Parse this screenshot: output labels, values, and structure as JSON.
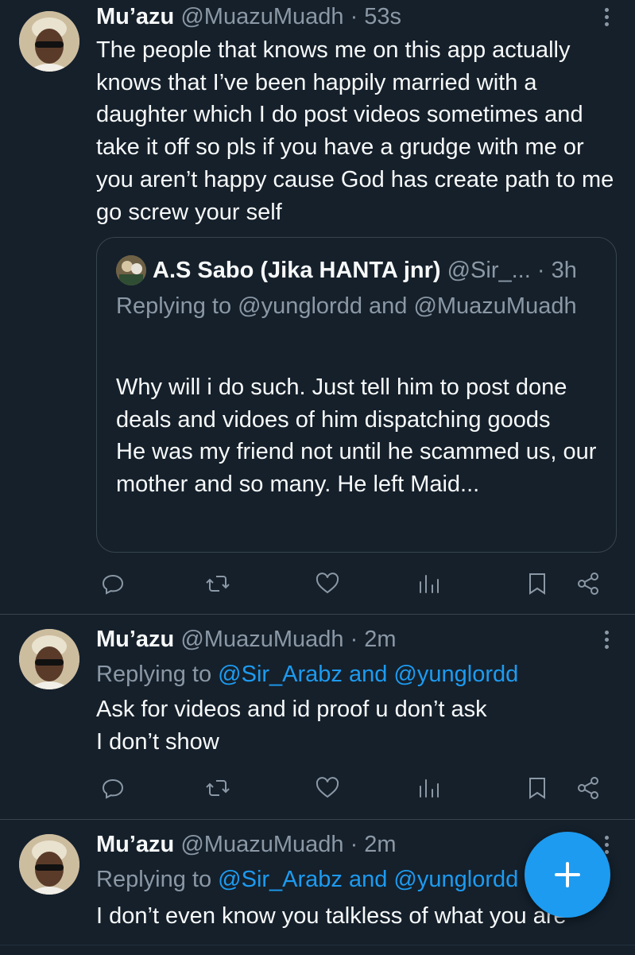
{
  "tweets": [
    {
      "display_name": "Mu’azu",
      "handle": "@MuazuMuadh",
      "time": "· 53s",
      "text": "The people that knows me on this app actually knows that I’ve been happily married with a daughter which I do post videos sometimes and take it off so pls if you have a grudge with me or you aren’t happy cause God has create path to me go screw your self",
      "quote": {
        "display_name": "A.S Sabo (Jika HANTA jnr)",
        "handle": "@Sir_...",
        "time": "· 3h",
        "replying": "Replying to @yunglordd and @MuazuMuadh",
        "text_line1": "Why will i do such. Just tell him to post done deals and vidoes of him dispatching goods",
        "text_line2": "He was my friend not until he scammed us, our mother and so many. He left Maid..."
      }
    },
    {
      "display_name": "Mu’azu",
      "handle": "@MuazuMuadh",
      "time": "· 2m",
      "replying_prefix": "Replying to ",
      "replying_links": "@Sir_Arabz and @yunglordd",
      "text_line1": "Ask for videos and id proof u don’t ask",
      "text_line2": "I don’t show"
    },
    {
      "display_name": "Mu’azu",
      "handle": "@MuazuMuadh",
      "time": "· 2m",
      "replying_prefix": "Replying to ",
      "replying_links": "@Sir_Arabz and @yunglordd",
      "text": "I don’t even know you talkless of what you are"
    }
  ],
  "icons": {
    "reply": "reply-icon",
    "retweet": "retweet-icon",
    "like": "heart-icon",
    "views": "views-icon",
    "bookmark": "bookmark-icon",
    "share": "share-icon",
    "compose": "plus-icon"
  },
  "colors": {
    "background": "#15202b",
    "text": "#f7f9f9",
    "muted": "#8b98a5",
    "link": "#1d9bf0",
    "border": "#38444d",
    "fab": "#1d9bf0"
  }
}
